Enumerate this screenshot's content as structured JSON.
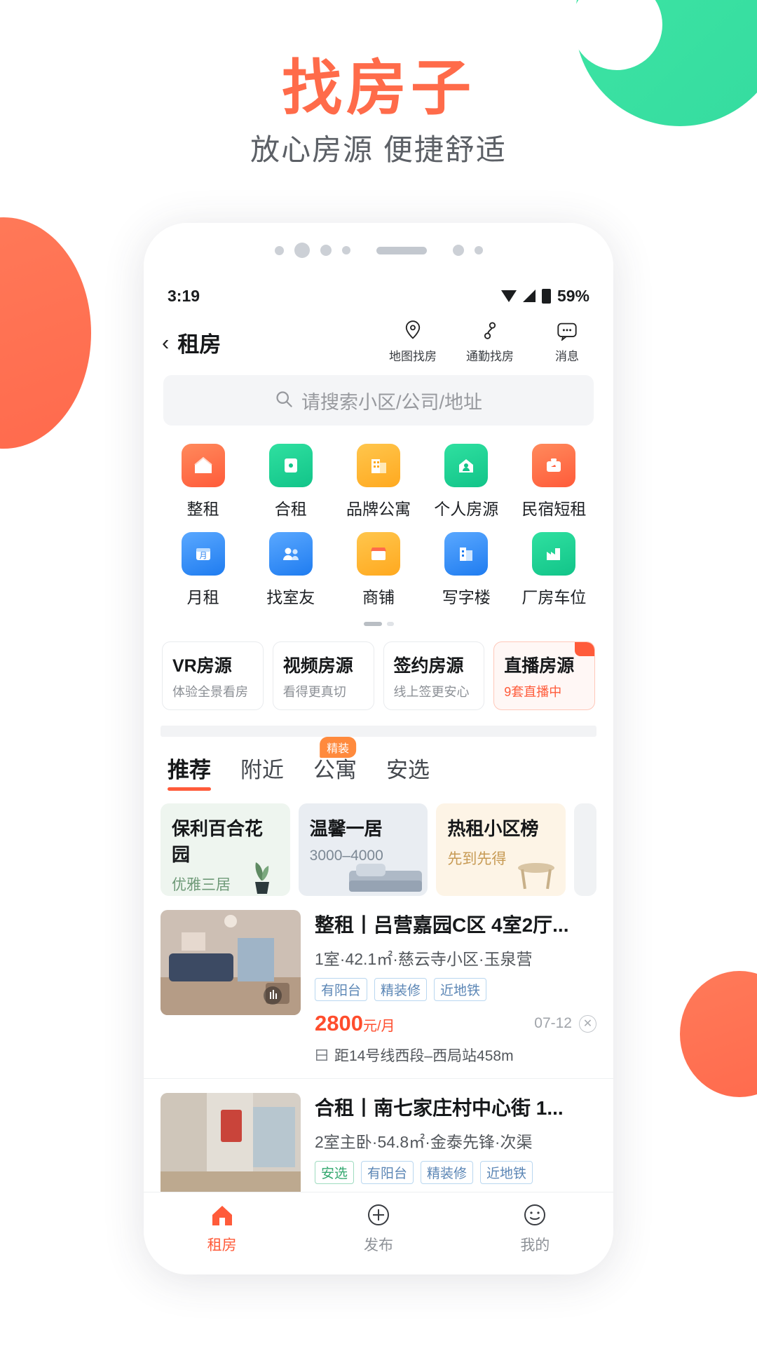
{
  "hero": {
    "title": "找房子",
    "subtitle": "放心房源 便捷舒适"
  },
  "phone": {
    "status": {
      "time": "3:19",
      "battery": "59%"
    },
    "nav": {
      "back_label": "‹",
      "title": "租房",
      "items": [
        {
          "label": "地图找房",
          "icon": "map-pin-icon"
        },
        {
          "label": "通勤找房",
          "icon": "commute-icon"
        },
        {
          "label": "消息",
          "icon": "message-icon"
        }
      ]
    },
    "search": {
      "placeholder": "请搜索小区/公司/地址",
      "icon": "search-icon"
    },
    "categories": [
      [
        {
          "label": "整租",
          "color": "#ff6b4a"
        },
        {
          "label": "合租",
          "color": "#17c98a"
        },
        {
          "label": "品牌公寓",
          "color": "#ffb020"
        },
        {
          "label": "个人房源",
          "color": "#17c98a"
        },
        {
          "label": "民宿短租",
          "color": "#ff6b4a"
        }
      ],
      [
        {
          "label": "月租",
          "color": "#2f8bff"
        },
        {
          "label": "找室友",
          "color": "#2f8bff"
        },
        {
          "label": "商铺",
          "color": "#ffb020"
        },
        {
          "label": "写字楼",
          "color": "#2f8bff"
        },
        {
          "label": "厂房车位",
          "color": "#17c98a"
        }
      ]
    ],
    "promos": [
      {
        "title": "VR房源",
        "sub": "体验全景看房"
      },
      {
        "title": "视频房源",
        "sub": "看得更真切"
      },
      {
        "title": "签约房源",
        "sub": "线上签更安心"
      },
      {
        "title": "直播房源",
        "sub": "9套直播中"
      }
    ],
    "tabs": [
      {
        "label": "推荐",
        "badge": ""
      },
      {
        "label": "附近",
        "badge": ""
      },
      {
        "label": "公寓",
        "badge": "精装"
      },
      {
        "label": "安选",
        "badge": ""
      }
    ],
    "feature_cards": [
      {
        "title": "保利百合花园",
        "sub": "优雅三居"
      },
      {
        "title": "温馨一居",
        "sub": "3000–4000"
      },
      {
        "title": "热租小区榜",
        "sub": "先到先得"
      }
    ],
    "listings": [
      {
        "title": "整租丨吕营嘉园C区 4室2厅...",
        "meta": "1室·42.1㎡·慈云寺小区·玉泉营",
        "tags": [
          "有阳台",
          "精装修",
          "近地铁"
        ],
        "price": "2800",
        "price_unit": "元/月",
        "date": "07-12",
        "subway": "距14号线西段–西局站458m"
      },
      {
        "title": "合租丨南七家庄村中心街 1...",
        "meta": "2室主卧·54.8㎡·金泰先锋·次渠",
        "tags": [
          "安选",
          "有阳台",
          "精装修",
          "近地铁"
        ],
        "price": "",
        "price_unit": "",
        "date": "",
        "subway": ""
      }
    ],
    "bottom_nav": [
      {
        "label": "租房",
        "icon": "home-icon",
        "active": true
      },
      {
        "label": "发布",
        "icon": "plus-circle-icon",
        "active": false
      },
      {
        "label": "我的",
        "icon": "smiley-icon",
        "active": false
      }
    ]
  },
  "colors": {
    "accent": "#ff5b3a",
    "green": "#17c98a",
    "blue": "#2f8bff"
  }
}
